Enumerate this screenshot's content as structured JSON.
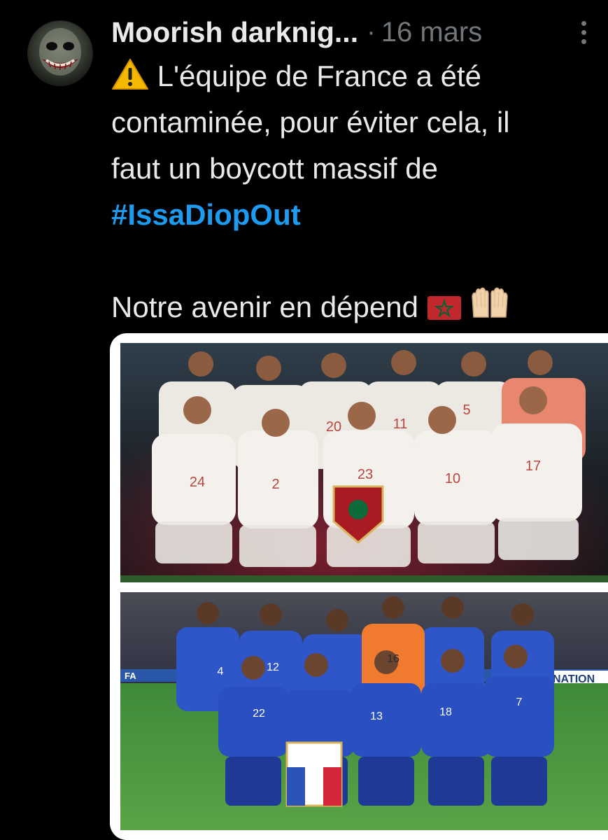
{
  "post": {
    "author_name": "Moorish darknig...",
    "separator": "·",
    "date": "16 mars",
    "text_lines": [
      "L'équipe de France a été",
      "contaminée, pour éviter cela, il",
      "faut un boycott massif de"
    ],
    "hashtag": "#IssaDiopOut",
    "closing_line": "Notre avenir en dépend"
  },
  "media": {
    "morocco_jerseys": [
      "24",
      "2",
      "20",
      "11",
      "5",
      "23",
      "10",
      "17"
    ],
    "france_jerseys": [
      "4",
      "12",
      "16",
      "22",
      "13",
      "18",
      "7"
    ],
    "banner_text": "NATION",
    "board_text": "FA"
  },
  "colors": {
    "background": "#000000",
    "text": "#e7e9ea",
    "muted": "#71767b",
    "link": "#1d9bf0"
  },
  "icons": [
    "more-vert-icon",
    "warning-emoji",
    "morocco-flag-emoji",
    "raised-hands-emoji"
  ]
}
